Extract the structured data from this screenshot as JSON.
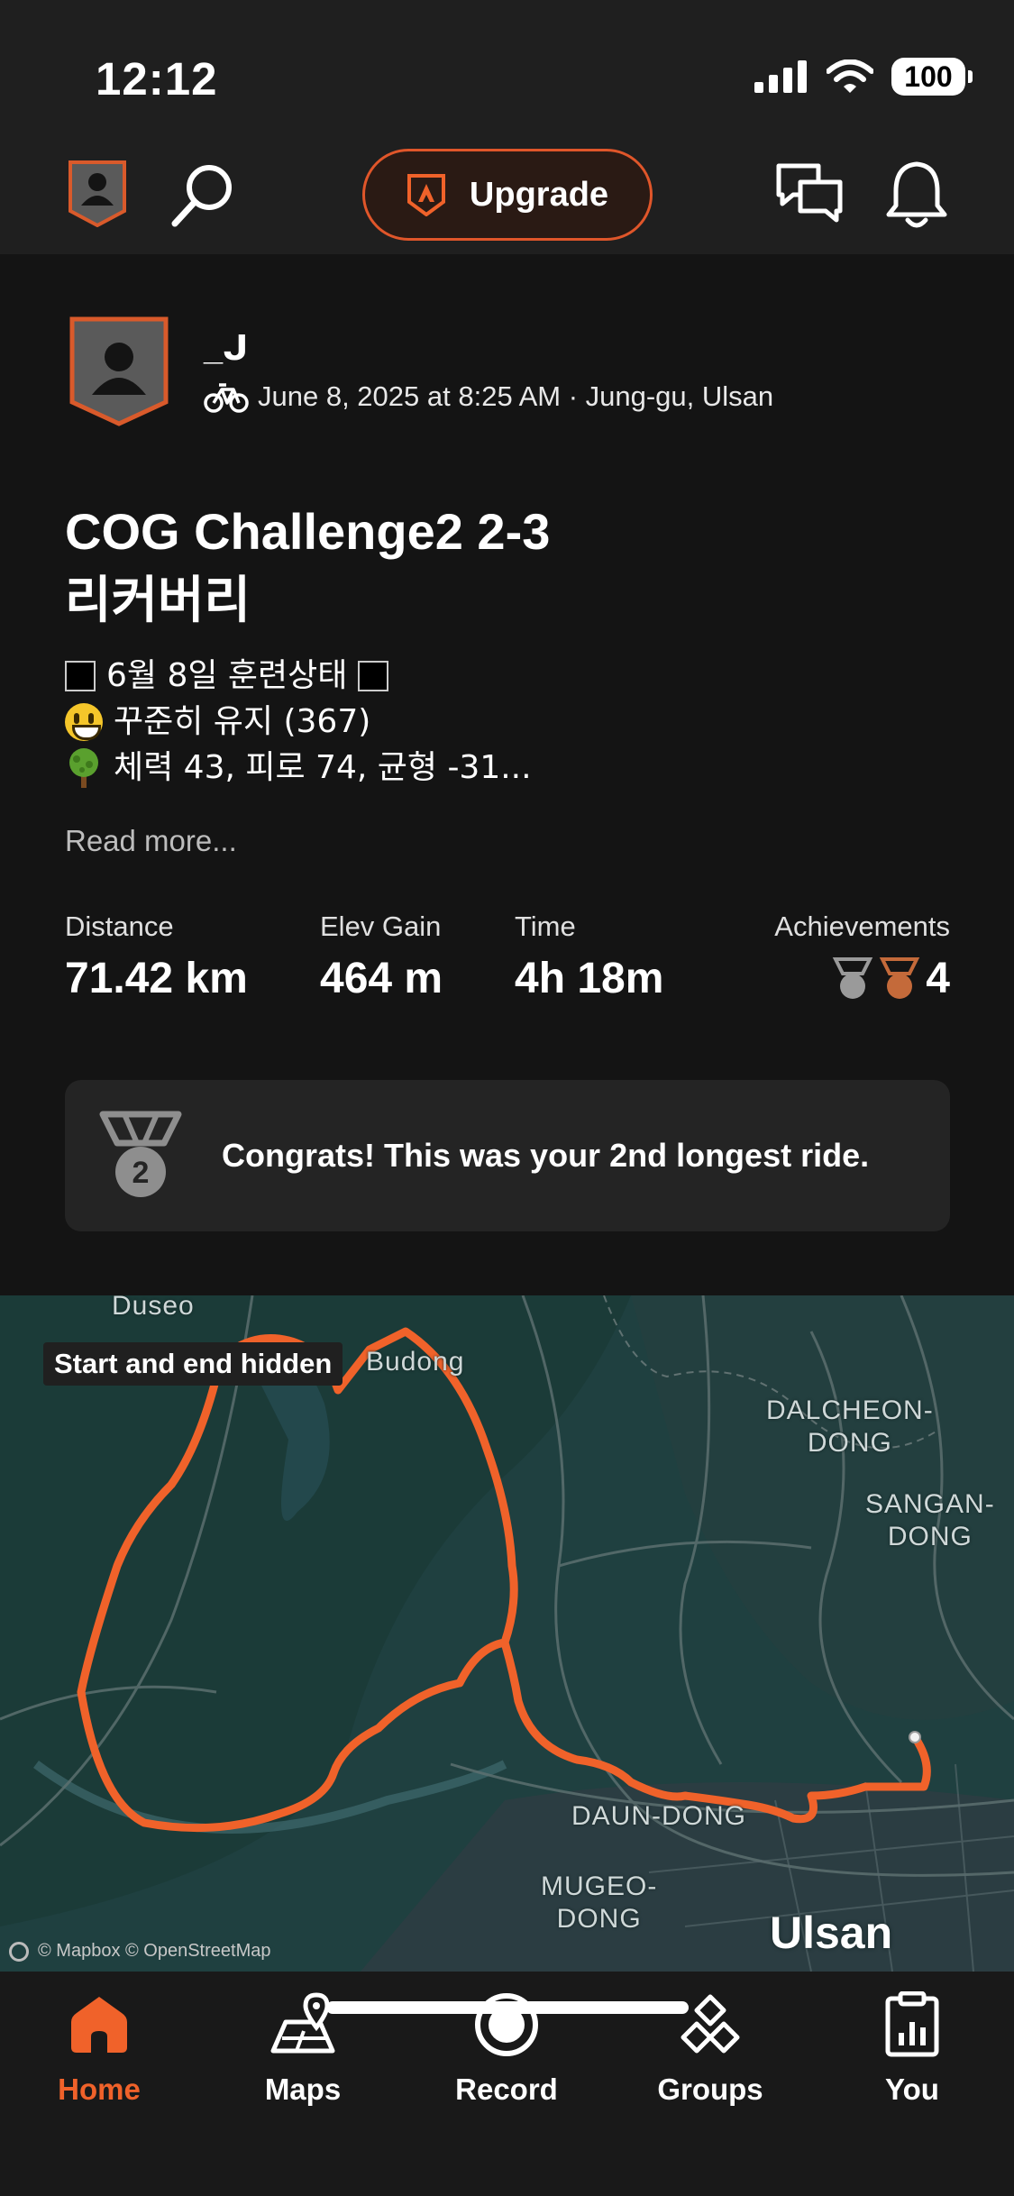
{
  "status_bar": {
    "time": "12:12",
    "battery": "100"
  },
  "top_nav": {
    "upgrade_label": "Upgrade"
  },
  "activity": {
    "athlete_name": "_ᒍ",
    "meta": "June 8, 2025 at 8:25 AM · Jung-gu, Ulsan",
    "title_line1": "COG Challenge2 2-3",
    "title_line2": "리커버리",
    "description": {
      "line1": "6월 8일 훈련상태",
      "line2": "꾸준히 유지 (367)",
      "line3": "체력 43, 피로 74, 균형 -31..."
    },
    "read_more": "Read more...",
    "stats": {
      "distance_label": "Distance",
      "distance_value": "71.42 km",
      "elev_label": "Elev Gain",
      "elev_value": "464 m",
      "time_label": "Time",
      "time_value": "4h 18m",
      "achievements_label": "Achievements",
      "achievements_count": "4"
    },
    "congrats": {
      "medal_number": "2",
      "text": "Congrats! This was your 2nd longest ride."
    }
  },
  "map": {
    "chip": "Start and end hidden",
    "labels": {
      "duseo": "Duseo",
      "budong": "Budong",
      "dalcheon1": "DALCHEON-",
      "dalcheon2": "DONG",
      "sangan1": "SANGAN-",
      "sangan2": "DONG",
      "daun": "DAUN-DONG",
      "mugeo1": "MUGEO-",
      "mugeo2": "DONG",
      "city": "Ulsan"
    },
    "attribution": "© Mapbox © OpenStreetMap",
    "route_color": "#f0622a"
  },
  "tabs": {
    "home": "Home",
    "maps": "Maps",
    "record": "Record",
    "groups": "Groups",
    "you": "You"
  },
  "colors": {
    "accent": "#f0622a",
    "background": "#141414",
    "card": "#242424"
  }
}
